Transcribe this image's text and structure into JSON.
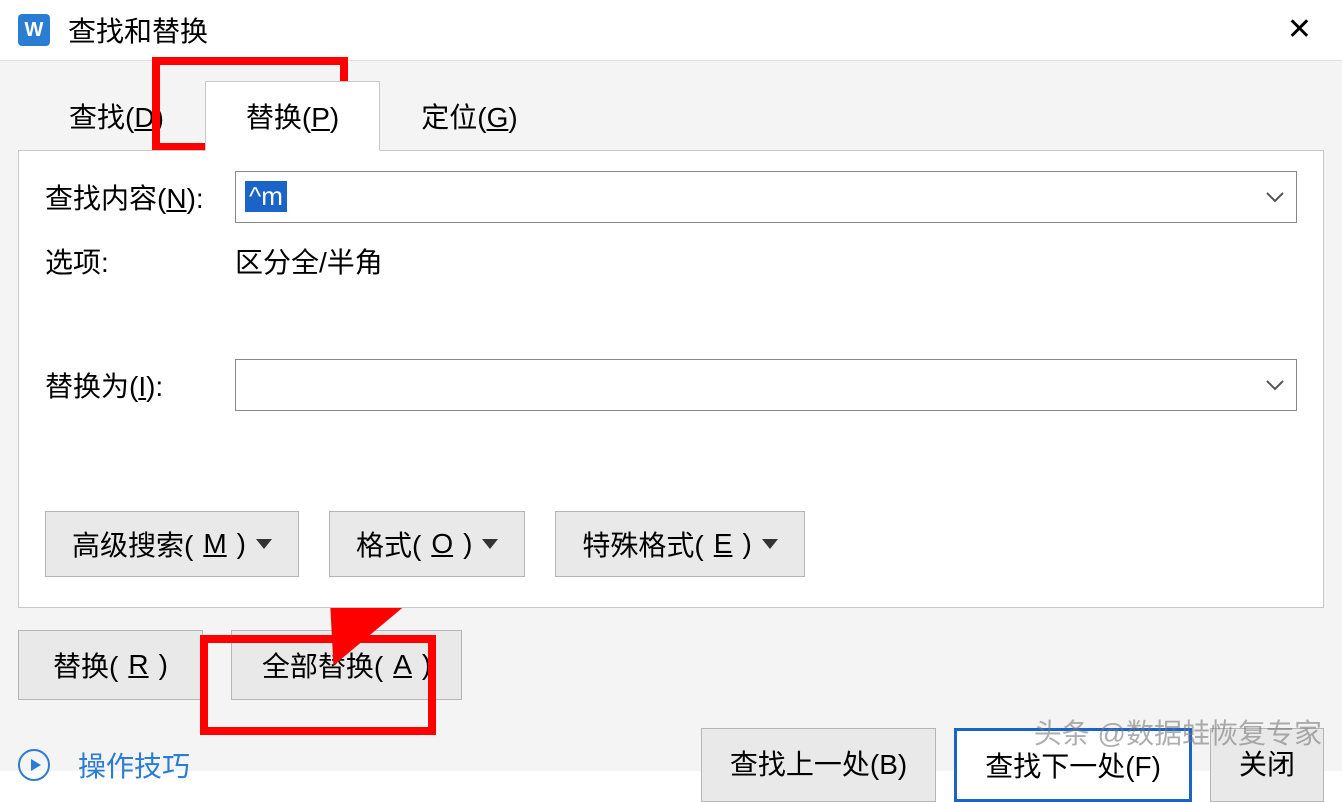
{
  "titlebar": {
    "appicon_letter": "W",
    "title": "查找和替换"
  },
  "tabs": {
    "find": "查找(D)",
    "replace": "替换(P)",
    "goto": "定位(G)"
  },
  "labels": {
    "find_what": "查找内容(N):",
    "options": "选项:",
    "replace_with": "替换为(I):"
  },
  "values": {
    "find_what": "^m",
    "options": "区分全/半角",
    "replace_with": ""
  },
  "buttons": {
    "advanced": "高级搜索(M)",
    "format": "格式(O)",
    "special": "特殊格式(E)",
    "replace": "替换(R)",
    "replace_all": "全部替换(A)",
    "find_prev": "查找上一处(B)",
    "find_next": "查找下一处(F)",
    "close": "关闭"
  },
  "link": {
    "tips": "操作技巧"
  },
  "watermark": "头条 @数据蛙恢复专家"
}
